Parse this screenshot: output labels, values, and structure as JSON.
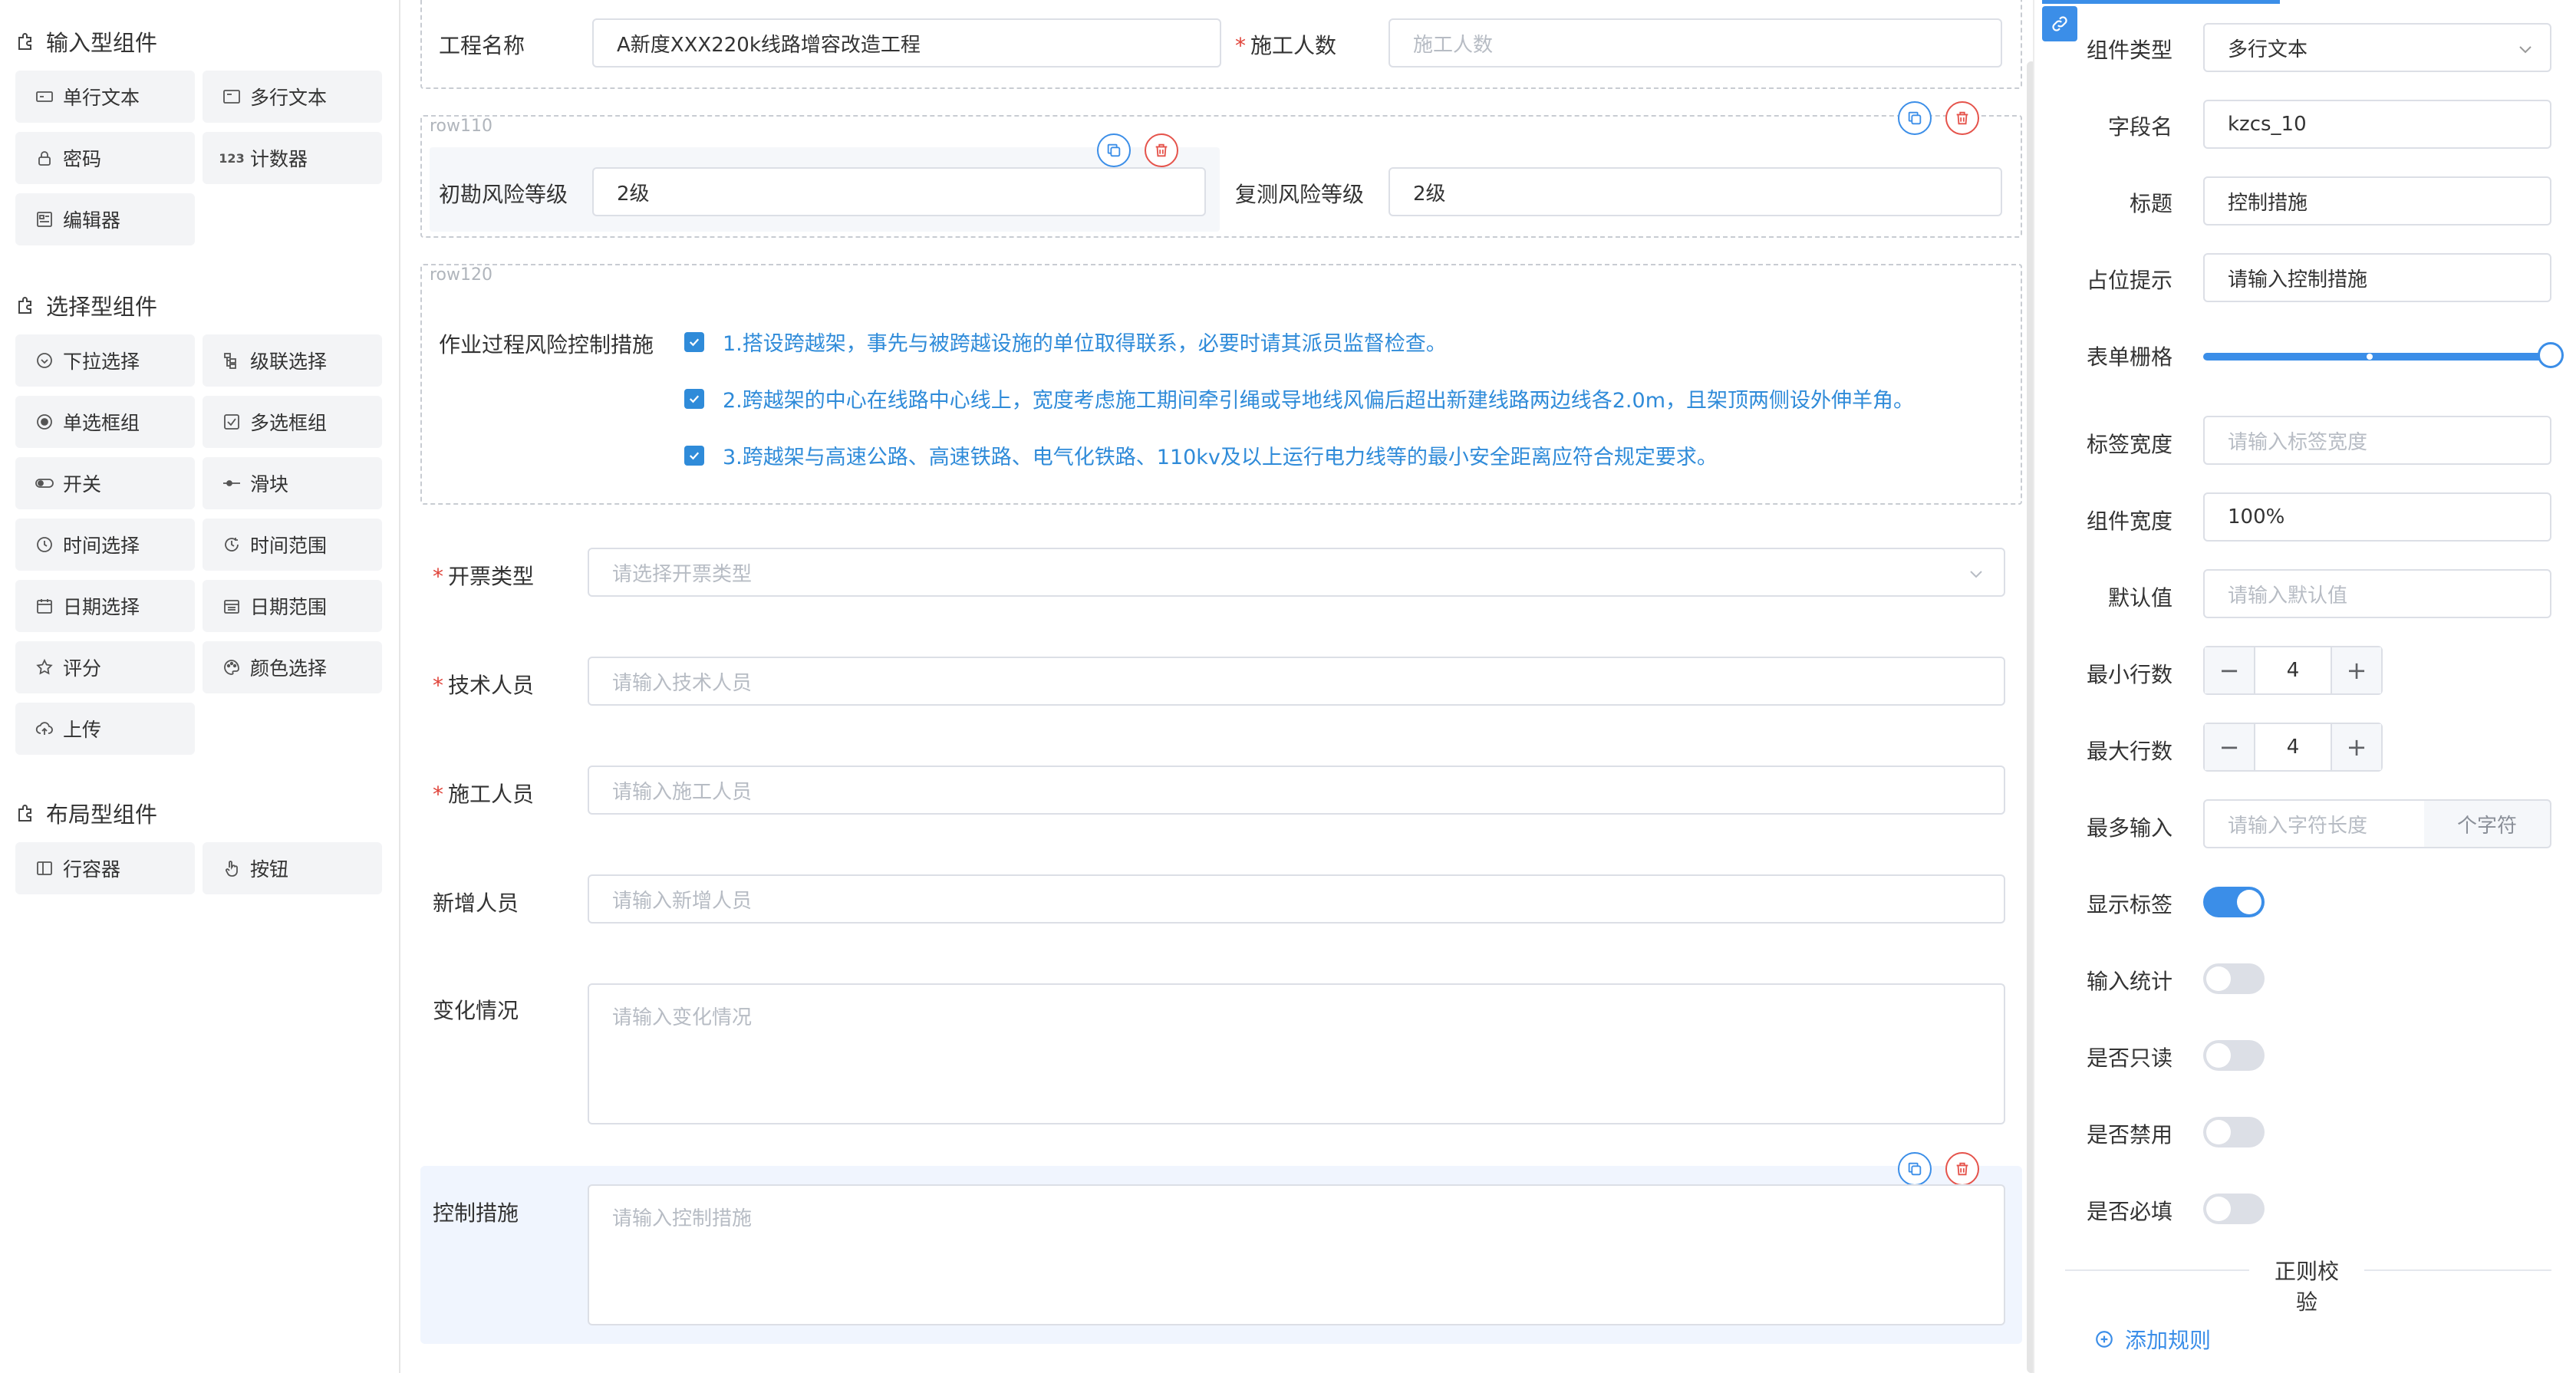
{
  "left": {
    "sections": [
      {
        "title": "输入型组件",
        "items": [
          {
            "label": "单行文本",
            "icon": "single-line-text-icon"
          },
          {
            "label": "多行文本",
            "icon": "multi-line-text-icon"
          },
          {
            "label": "密码",
            "icon": "lock-icon"
          },
          {
            "label": "计数器",
            "icon": "counter-icon"
          },
          {
            "label": "编辑器",
            "icon": "editor-icon"
          }
        ]
      },
      {
        "title": "选择型组件",
        "items": [
          {
            "label": "下拉选择",
            "icon": "dropdown-icon"
          },
          {
            "label": "级联选择",
            "icon": "cascader-icon"
          },
          {
            "label": "单选框组",
            "icon": "radio-icon"
          },
          {
            "label": "多选框组",
            "icon": "checkbox-icon"
          },
          {
            "label": "开关",
            "icon": "switch-icon"
          },
          {
            "label": "滑块",
            "icon": "slider-icon"
          },
          {
            "label": "时间选择",
            "icon": "clock-icon"
          },
          {
            "label": "时间范围",
            "icon": "time-range-icon"
          },
          {
            "label": "日期选择",
            "icon": "calendar-icon"
          },
          {
            "label": "日期范围",
            "icon": "date-range-icon"
          },
          {
            "label": "评分",
            "icon": "star-icon"
          },
          {
            "label": "颜色选择",
            "icon": "palette-icon"
          },
          {
            "label": "上传",
            "icon": "upload-icon"
          }
        ]
      },
      {
        "title": "布局型组件",
        "items": [
          {
            "label": "行容器",
            "icon": "row-container-icon"
          },
          {
            "label": "按钮",
            "icon": "hand-pointer-icon"
          }
        ]
      }
    ]
  },
  "center": {
    "top_row": {
      "project_label": "工程名称",
      "project_value": "A新度XXX220k线路增容改造工程",
      "workers_label": "施工人数",
      "workers_placeholder": "施工人数"
    },
    "row110": {
      "tag": "row110",
      "initial_risk_label": "初勘风险等级",
      "initial_risk_value": "2级",
      "recheck_risk_label": "复测风险等级",
      "recheck_risk_value": "2级"
    },
    "row120": {
      "tag": "row120",
      "label": "作业过程风险控制措施",
      "options": [
        "1.搭设跨越架，事先与被跨越设施的单位取得联系，必要时请其派员监督检查。",
        "2.跨越架的中心在线路中心线上，宽度考虑施工期间牵引绳或导地线风偏后超出新建线路两边线各2.0m，且架顶两侧设外伸羊角。",
        "3.跨越架与高速公路、高速铁路、电气化铁路、110kv及以上运行电力线等的最小安全距离应符合规定要求。"
      ]
    },
    "fields": {
      "ticket_type_label": "开票类型",
      "ticket_type_placeholder": "请选择开票类型",
      "tech_label": "技术人员",
      "tech_placeholder": "请输入技术人员",
      "worker_label": "施工人员",
      "worker_placeholder": "请输入施工人员",
      "new_label": "新增人员",
      "new_placeholder": "请输入新增人员",
      "change_label": "变化情况",
      "change_placeholder": "请输入变化情况",
      "control_label": "控制措施",
      "control_placeholder": "请输入控制措施"
    }
  },
  "right": {
    "component_type_label": "组件类型",
    "component_type_value": "多行文本",
    "field_name_label": "字段名",
    "field_name_value": "kzcs_10",
    "title_label": "标题",
    "title_value": "控制措施",
    "placeholder_label": "占位提示",
    "placeholder_value": "请输入控制措施",
    "grid_label": "表单栅格",
    "grid_value": 24,
    "label_width_label": "标签宽度",
    "label_width_placeholder": "请输入标签宽度",
    "comp_width_label": "组件宽度",
    "comp_width_value": "100%",
    "default_label": "默认值",
    "default_placeholder": "请输入默认值",
    "min_rows_label": "最小行数",
    "min_rows_value": "4",
    "max_rows_label": "最大行数",
    "max_rows_value": "4",
    "max_input_label": "最多输入",
    "max_input_placeholder": "请输入字符长度",
    "max_input_suffix": "个字符",
    "toggles": [
      {
        "label": "显示标签",
        "on": true
      },
      {
        "label": "输入统计",
        "on": false
      },
      {
        "label": "是否只读",
        "on": false
      },
      {
        "label": "是否禁用",
        "on": false
      },
      {
        "label": "是否必填",
        "on": false
      }
    ],
    "regex_title": "正则校验",
    "add_rule": "添加规则"
  },
  "colors": {
    "accent": "#3b8ee8",
    "danger": "#e5534b",
    "checkbox_text": "#2f8bd9"
  }
}
